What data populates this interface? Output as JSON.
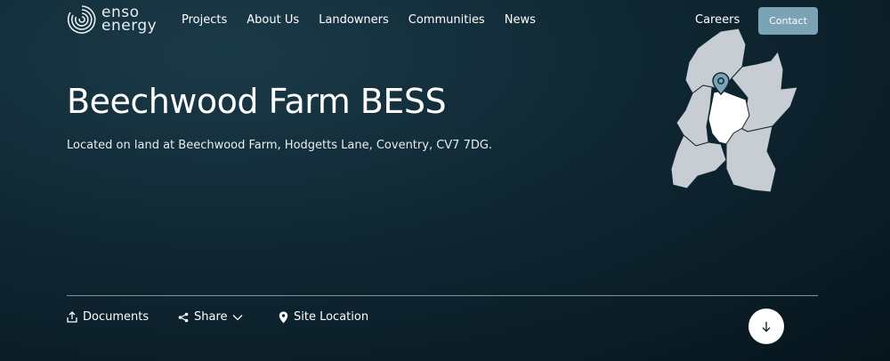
{
  "brand": {
    "line1": "enso",
    "line2": "energy"
  },
  "nav": [
    {
      "label": "Projects"
    },
    {
      "label": "About Us"
    },
    {
      "label": "Landowners"
    },
    {
      "label": "Communities"
    },
    {
      "label": "News"
    }
  ],
  "header": {
    "careers": "Careers",
    "contact": "Contact"
  },
  "hero": {
    "title": "Beechwood Farm BESS",
    "subtitle": "Located on land at Beechwood Farm, Hodgetts Lane, Coventry, CV7 7DG."
  },
  "actions": {
    "documents": "Documents",
    "share": "Share",
    "site_location": "Site Location"
  },
  "icons": [
    "logo-rings-icon",
    "upload-icon",
    "share-icon",
    "chevron-down-icon",
    "location-pin-icon",
    "arrow-down-icon",
    "map-pin-icon"
  ],
  "colors": {
    "background": "#0f2733",
    "accent": "#7ba3b6",
    "map_fill": "#c8cdd3",
    "map_highlight": "#ffffff"
  }
}
